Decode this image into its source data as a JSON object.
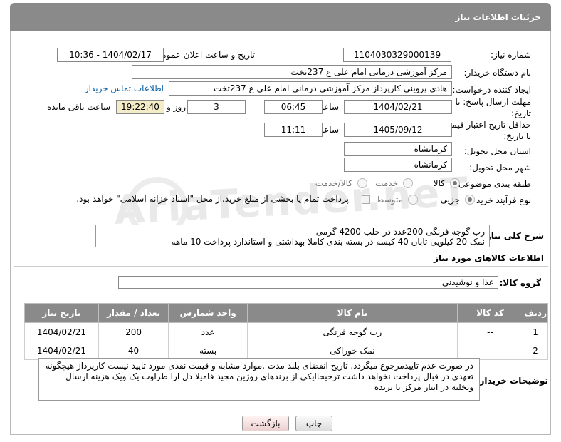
{
  "header": {
    "title": "جزئیات اطلاعات نیاز"
  },
  "fields": {
    "need_number": {
      "label": "شماره نیاز:",
      "value": "1104030329000139"
    },
    "announce_datetime": {
      "label": "تاریخ و ساعت اعلان عمومی:",
      "value": "1404/02/17 - 10:36"
    },
    "buyer_org": {
      "label": "نام دستگاه خریدار:",
      "value": "مرکز آموزشی درمانی امام علی ع 237تخت"
    },
    "requester": {
      "label": "ایجاد کننده درخواست:",
      "value": "هادی پروینی کارپرداز  مرکز آموزشی درمانی امام علی ع 237تخت",
      "contact_link": "اطلاعات تماس خریدار"
    },
    "deadline": {
      "label_line1": "مهلت ارسال پاسخ: تا",
      "label_line2": "تاریخ:",
      "date": "1404/02/21",
      "time_label": "ساعت",
      "time": "06:45",
      "days": "3",
      "days_label": "روز و",
      "remaining": "19:22:40",
      "remaining_label": "ساعت باقی مانده"
    },
    "price_validity": {
      "label_line1": "حداقل تاریخ اعتبار قیمت:",
      "label_line2": "تا تاریخ:",
      "date": "1405/09/12",
      "time_label": "ساعت",
      "time": "11:11"
    },
    "delivery_province": {
      "label": "استان محل تحویل:",
      "value": "کرمانشاه"
    },
    "delivery_city": {
      "label": "شهر محل تحویل:",
      "value": "کرمانشاه"
    },
    "subject_class": {
      "label": "طبقه بندی موضوعی:",
      "options": [
        "کالا",
        "خدمت",
        "کالا/خدمت"
      ],
      "selected": 0
    },
    "purchase_process": {
      "label": "نوع فرآیند خرید :",
      "options": [
        "جزیی",
        "متوسط"
      ],
      "selected": 0,
      "checkbox_text": "پرداخت تمام یا بخشی از مبلغ خرید،از محل \"اسناد خزانه اسلامی\" خواهد بود."
    }
  },
  "description": {
    "label": "شرح کلی نیاز:",
    "line1": "رب گوجه فرنگی 200عدد   در حلب 4200 گرمی",
    "line2": "نمک 20 کیلویی تابان  40 کیسه         در بسته بندی کاملا بهداشتی و استاندارد   پرداخت 10 ماهه"
  },
  "items_section": {
    "title": "اطلاعات کالاهای مورد نیاز",
    "group_label": "گروه کالا:",
    "group_value": "غذا و نوشیدنی"
  },
  "items_table": {
    "headers": [
      "ردیف",
      "کد کالا",
      "نام کالا",
      "واحد شمارش",
      "تعداد / مقدار",
      "تاریخ نیاز"
    ],
    "rows": [
      [
        "1",
        "--",
        "رب گوجه فرنگی",
        "عدد",
        "200",
        "1404/02/21"
      ],
      [
        "2",
        "--",
        "نمک خوراکی",
        "بسته",
        "40",
        "1404/02/21"
      ]
    ]
  },
  "buyer_notes": {
    "label": "توضیحات خریدار:",
    "text": "در صورت عدم تاییدمرجوع میگردد. تاریخ انقضای بلند مدت  .موارد مشابه و قیمت نقدی مورد تایید نیست کارپرداز هیچگونه تعهدی در قبال پرداخت نخواهد داشت ترجیحاایکی از برندهای روژین مجید فامیلا دل ارا طراوت یک ویک هزینه ارسال وتخلیه در انبار مرکز با برنده"
  },
  "buttons": {
    "print": "چاپ",
    "back": "بازگشت"
  },
  "watermark": "AriaTender.neT"
}
